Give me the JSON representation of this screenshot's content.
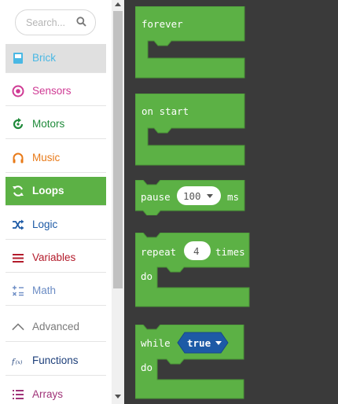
{
  "search": {
    "placeholder": "Search..."
  },
  "categories": [
    {
      "id": "brick",
      "label": "Brick",
      "color": "#4ab8e4",
      "icon": "brick-icon"
    },
    {
      "id": "sensors",
      "label": "Sensors",
      "color": "#cf3a94",
      "icon": "sensor-icon"
    },
    {
      "id": "motors",
      "label": "Motors",
      "color": "#1f8a3a",
      "icon": "motor-icon"
    },
    {
      "id": "music",
      "label": "Music",
      "color": "#e87a18",
      "icon": "headphones-icon"
    },
    {
      "id": "loops",
      "label": "Loops",
      "color": "#5cb145",
      "icon": "loop-icon"
    },
    {
      "id": "logic",
      "label": "Logic",
      "color": "#1d5aa6",
      "icon": "shuffle-icon"
    },
    {
      "id": "variables",
      "label": "Variables",
      "color": "#b31b2b",
      "icon": "list-icon"
    },
    {
      "id": "math",
      "label": "Math",
      "color": "#6b8cc4",
      "icon": "math-icon"
    },
    {
      "id": "advanced",
      "label": "Advanced",
      "color": "#7a7a7a",
      "icon": "chevron-up-icon"
    },
    {
      "id": "functions",
      "label": "Functions",
      "color": "#1d3f7a",
      "icon": "function-icon"
    },
    {
      "id": "arrays",
      "label": "Arrays",
      "color": "#a03479",
      "icon": "array-icon"
    }
  ],
  "blocks": {
    "forever": {
      "label": "forever"
    },
    "on_start": {
      "label": "on start"
    },
    "pause": {
      "label": "pause",
      "value": "100",
      "unit": "ms"
    },
    "repeat": {
      "label": "repeat",
      "value": "4",
      "suffix": "times",
      "do_label": "do"
    },
    "while": {
      "label": "while",
      "condition": "true",
      "do_label": "do"
    }
  },
  "colors": {
    "loops": "#5cb145",
    "logic_value": "#1d5aa6",
    "workspace": "#3a3a3a"
  }
}
